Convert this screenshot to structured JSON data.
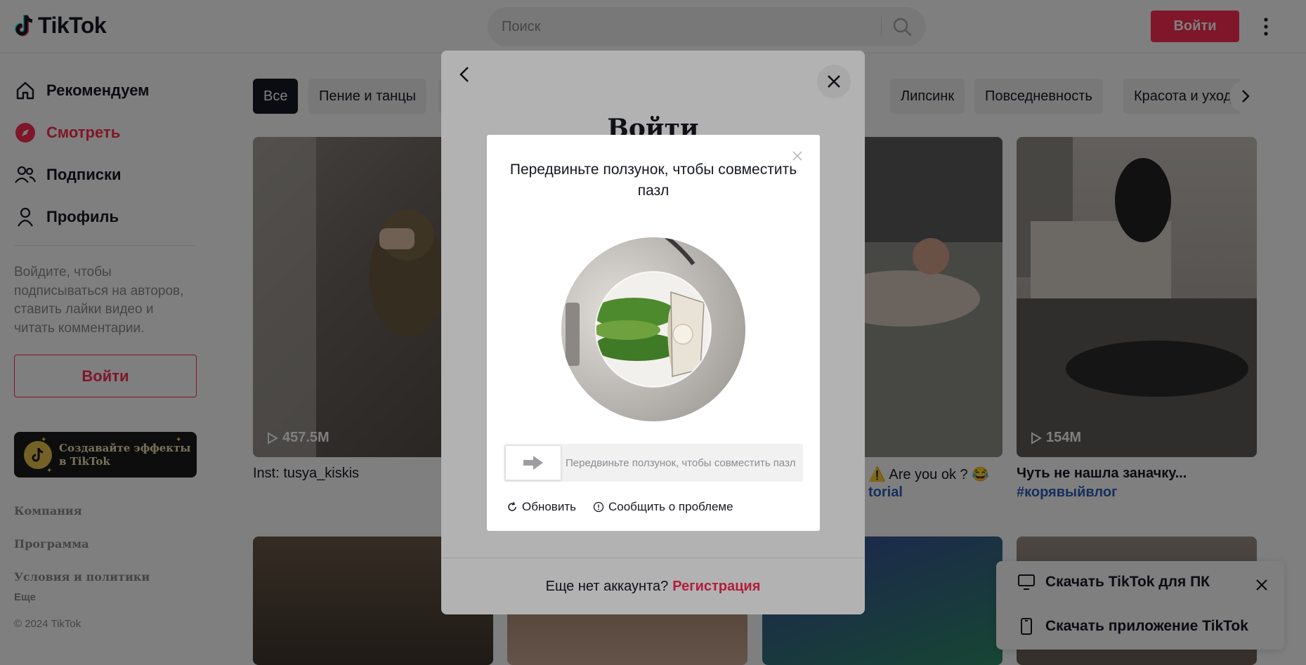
{
  "header": {
    "logo_text": "TikTok",
    "search_placeholder": "Поиск",
    "login_label": "Войти"
  },
  "sidebar": {
    "nav": [
      {
        "label": "Рекомендуем",
        "icon": "home-icon"
      },
      {
        "label": "Смотреть",
        "icon": "compass-icon",
        "active": true
      },
      {
        "label": "Подписки",
        "icon": "following-icon"
      },
      {
        "label": "Профиль",
        "icon": "profile-icon"
      }
    ],
    "login_hint": "Войдите, чтобы подписываться на авторов, ставить лайки видео и читать комментарии.",
    "login_label": "Войти",
    "effects_text": "Создавайте эффекты в TikTok",
    "footer": {
      "company": "Компания",
      "program": "Программа",
      "terms": "Условия и политики",
      "more": "Еще",
      "copyright": "© 2024 TikTok"
    }
  },
  "chips": [
    "Все",
    "Пение и танцы",
    "…",
    "Липсинк",
    "Повседневность",
    "Красота и уход"
  ],
  "videos": [
    {
      "views": "457.5M",
      "caption": "Inst: tusya_kiskis",
      "hashtag": ""
    },
    {
      "views": "",
      "caption": "⚠️ Are you ok ? 😂",
      "hashtag": "torial"
    },
    {
      "views": "154M",
      "caption": "Чуть не нашла заначку...",
      "hashtag": "#корявыйвлог"
    }
  ],
  "download": {
    "pc": "Скачать TikTok для ПК",
    "app": "Скачать приложение TikTok"
  },
  "login_modal": {
    "title": "Войти",
    "footer_text": "Еще нет аккаунта?",
    "signup": "Регистрация"
  },
  "captcha": {
    "title": "Передвиньте ползунок, чтобы совместить пазл",
    "slider_hint": "Передвиньте ползунок, чтобы совместить пазл",
    "refresh": "Обновить",
    "report": "Сообщить о проблеме"
  },
  "colors": {
    "accent": "#fe2c55",
    "text": "#161823",
    "muted": "#8a8b91",
    "hashtag": "#2b5db9"
  }
}
